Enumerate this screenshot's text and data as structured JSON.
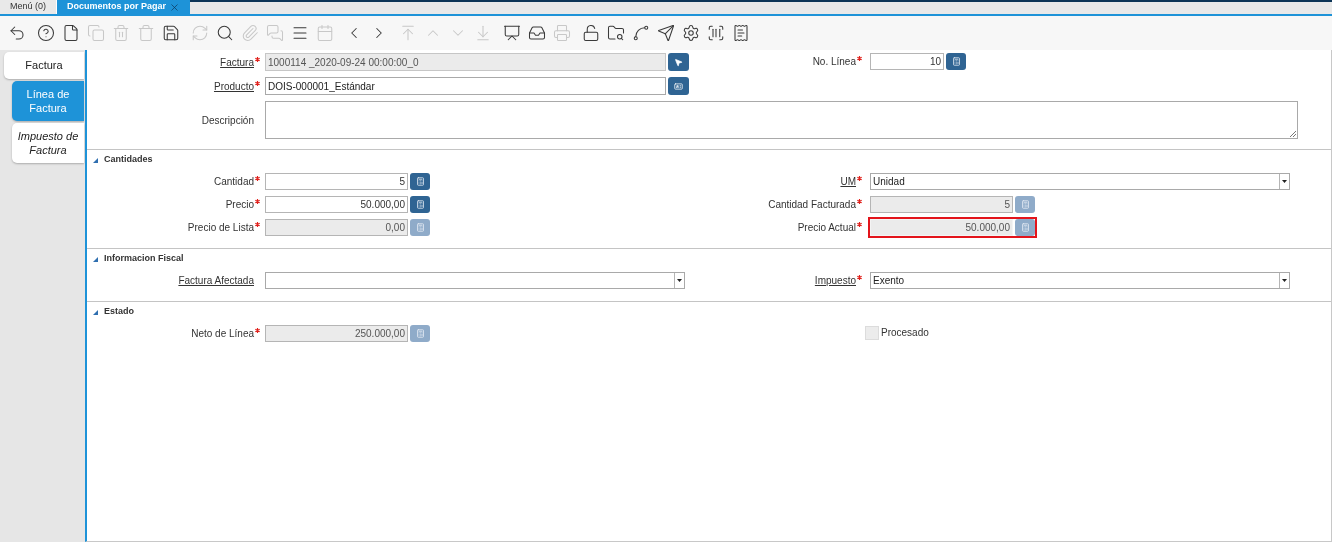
{
  "window_tabs": [
    {
      "label": "Menú (0)",
      "selected": false,
      "closable": false
    },
    {
      "label": "Documentos por Pagar",
      "selected": true,
      "closable": true
    }
  ],
  "toolbar": [
    [
      {
        "kind": "undo",
        "disabled": false
      }
    ],
    [
      {
        "kind": "help",
        "disabled": false
      },
      {
        "kind": "new",
        "disabled": false
      },
      {
        "kind": "copy",
        "disabled": true
      },
      {
        "kind": "delete",
        "disabled": true
      },
      {
        "kind": "delete-selection",
        "disabled": true
      },
      {
        "kind": "save",
        "disabled": false
      }
    ],
    [
      {
        "kind": "refresh",
        "disabled": true
      },
      {
        "kind": "find",
        "disabled": false
      },
      {
        "kind": "attach",
        "disabled": true
      },
      {
        "kind": "chat",
        "disabled": true
      },
      {
        "kind": "grid",
        "disabled": false
      },
      {
        "kind": "calendar",
        "disabled": true
      }
    ],
    [
      {
        "kind": "previous",
        "disabled": false
      },
      {
        "kind": "next",
        "disabled": false
      }
    ],
    [
      {
        "kind": "first",
        "disabled": true
      },
      {
        "kind": "parent",
        "disabled": true
      },
      {
        "kind": "detail",
        "disabled": true
      },
      {
        "kind": "last",
        "disabled": true
      }
    ],
    [
      {
        "kind": "report",
        "disabled": false
      },
      {
        "kind": "archive",
        "disabled": false
      },
      {
        "kind": "print",
        "disabled": true
      }
    ],
    [
      {
        "kind": "lock",
        "disabled": false
      },
      {
        "kind": "zoom-across",
        "disabled": false
      },
      {
        "kind": "workflow",
        "disabled": false
      },
      {
        "kind": "send",
        "disabled": false
      },
      {
        "kind": "process",
        "disabled": false
      },
      {
        "kind": "barcode",
        "disabled": false
      },
      {
        "kind": "document",
        "disabled": false
      }
    ]
  ],
  "side_tabs": [
    {
      "label": "Factura",
      "selected": false,
      "italic": false,
      "children": [
        {
          "label": "Línea de Factura",
          "selected": true,
          "italic": false
        },
        {
          "label": "Impuesto de Factura",
          "selected": false,
          "italic": true
        }
      ]
    }
  ],
  "sections": [
    {
      "rows": [
        [
          {
            "label": "Factura",
            "link": true,
            "required": true,
            "kind": "record",
            "value": "1000114 _2020-09-24 00:00:00_0",
            "readonly": true,
            "highlighted": false
          },
          {
            "label": "No. Línea",
            "link": false,
            "required": true,
            "kind": "short-number",
            "value": "10",
            "readonly": false,
            "highlighted": false
          }
        ],
        [
          {
            "label": "Producto",
            "link": true,
            "required": true,
            "kind": "product",
            "value": "DOIS-000001_Estándar",
            "readonly": false,
            "highlighted": false
          }
        ],
        [
          {
            "label": "Descripción",
            "link": false,
            "required": false,
            "kind": "textarea",
            "readonly": false,
            "highlighted": false
          }
        ]
      ]
    },
    {
      "title": "Cantidades",
      "expanded": true,
      "rows": [
        [
          {
            "label": "Cantidad",
            "link": false,
            "required": true,
            "kind": "number",
            "value": "5",
            "readonly": false,
            "highlighted": false
          },
          {
            "label": "UM",
            "link": true,
            "required": true,
            "kind": "select",
            "value": "Unidad",
            "readonly": false,
            "highlighted": false
          }
        ],
        [
          {
            "label": "Precio",
            "link": false,
            "required": true,
            "kind": "number",
            "value": "50.000,00",
            "readonly": false,
            "highlighted": false
          },
          {
            "label": "Cantidad Facturada",
            "link": false,
            "required": true,
            "kind": "number",
            "value": "5",
            "readonly": true,
            "highlighted": false
          }
        ],
        [
          {
            "label": "Precio de Lista",
            "link": false,
            "required": true,
            "kind": "number",
            "value": "0,00",
            "readonly": true,
            "highlighted": false
          },
          {
            "label": "Precio Actual",
            "link": false,
            "required": true,
            "kind": "number",
            "value": "50.000,00",
            "readonly": true,
            "highlighted": true
          }
        ]
      ]
    },
    {
      "title": "Informacion Fiscal",
      "expanded": true,
      "rows": [
        [
          {
            "label": "Factura Afectada",
            "link": true,
            "required": false,
            "kind": "select",
            "readonly": false,
            "highlighted": false
          },
          {
            "label": "Impuesto",
            "link": true,
            "required": true,
            "kind": "select",
            "value": "Exento",
            "readonly": false,
            "highlighted": false
          }
        ]
      ]
    },
    {
      "title": "Estado",
      "expanded": true,
      "rows": [
        [
          {
            "label": "Neto de Línea",
            "link": false,
            "required": true,
            "kind": "number",
            "value": "250.000,00",
            "readonly": true,
            "highlighted": false
          },
          {
            "label": "Procesado",
            "kind": "checkbox",
            "checked": false,
            "readonly": true,
            "highlighted": false
          }
        ]
      ]
    }
  ]
}
